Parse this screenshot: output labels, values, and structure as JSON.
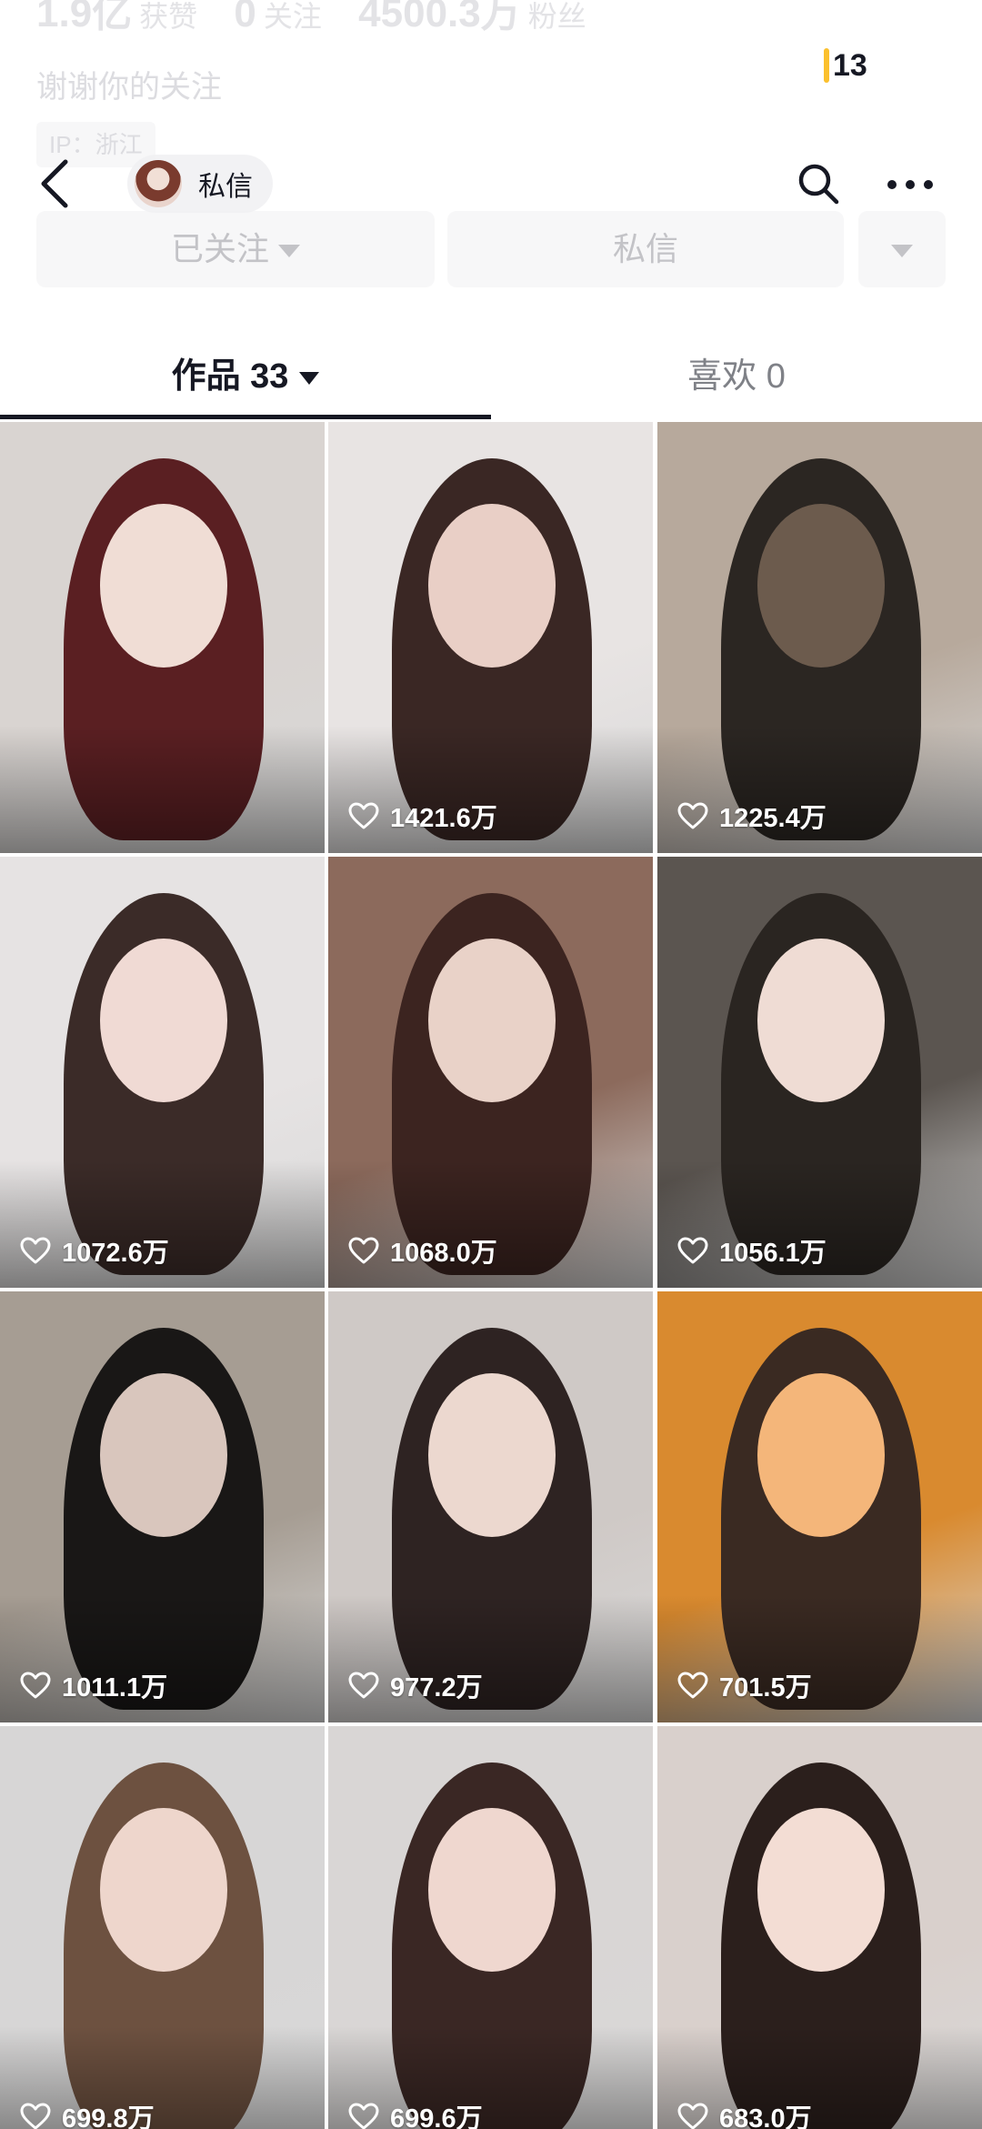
{
  "profile": {
    "stats": [
      {
        "value": "1.9亿",
        "label": "获赞"
      },
      {
        "value": "0",
        "label": "关注"
      },
      {
        "value": "4500.3万",
        "label": "粉丝"
      }
    ],
    "bio": "谢谢你的关注",
    "ip": "IP：浙江",
    "buttons": {
      "follow": "已关注",
      "message": "私信"
    }
  },
  "counter": "13",
  "nav": {
    "dm_label": "私信"
  },
  "tabs": [
    {
      "label": "作品 33"
    },
    {
      "label": "喜欢 0"
    }
  ],
  "videos": [
    {
      "likes": "",
      "colors": [
        "#d9d4d1",
        "#5a1f22",
        "#f0ddd5"
      ]
    },
    {
      "likes": "1421.6万",
      "colors": [
        "#e8e4e3",
        "#3a2724",
        "#e9cfc6"
      ]
    },
    {
      "likes": "1225.4万",
      "colors": [
        "#b7a99c",
        "#2b2622",
        "#6c5b4d"
      ]
    },
    {
      "likes": "1072.6万",
      "colors": [
        "#e6e3e3",
        "#3b2b28",
        "#f0dad4"
      ]
    },
    {
      "likes": "1068.0万",
      "colors": [
        "#8c6a5c",
        "#3c2420",
        "#e9d2c8"
      ]
    },
    {
      "likes": "1056.1万",
      "colors": [
        "#5b5550",
        "#2a2521",
        "#efdcd4"
      ]
    },
    {
      "likes": "1011.1万",
      "colors": [
        "#a69d93",
        "#191716",
        "#d9c6bd"
      ]
    },
    {
      "likes": "977.2万",
      "colors": [
        "#cfc9c6",
        "#2e2322",
        "#ecd8cf"
      ]
    },
    {
      "likes": "701.5万",
      "colors": [
        "#d98a2f",
        "#3a2a22",
        "#f4b67a"
      ]
    },
    {
      "likes": "699.8万",
      "colors": [
        "#d7d6d6",
        "#6d5140",
        "#eed6cc"
      ]
    },
    {
      "likes": "699.6万",
      "colors": [
        "#d9d6d5",
        "#3a2724",
        "#efd7cf"
      ]
    },
    {
      "likes": "683.0万",
      "colors": [
        "#d9d0cc",
        "#2b1f1c",
        "#f3ddd4"
      ]
    }
  ]
}
